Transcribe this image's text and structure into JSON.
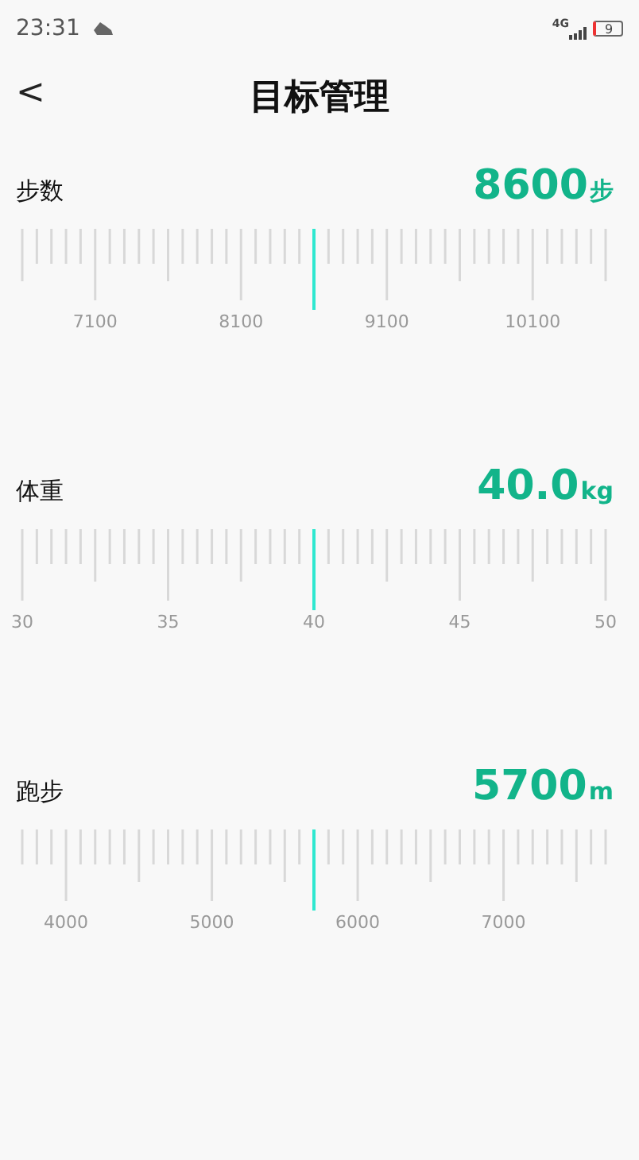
{
  "status_bar": {
    "time": "23:31",
    "network": "4G",
    "battery": "9"
  },
  "header": {
    "back": "<",
    "title": "目标管理"
  },
  "goals": [
    {
      "label": "步数",
      "value": "8600",
      "unit": "步",
      "scale_labels": [
        "7100",
        "8100",
        "9100",
        "10100"
      ]
    },
    {
      "label": "体重",
      "value": "40.0",
      "unit": "kg",
      "scale_labels": [
        "30",
        "35",
        "40",
        "45",
        "50"
      ]
    },
    {
      "label": "跑步",
      "value": "5700",
      "unit": "m",
      "scale_labels": [
        "4000",
        "5000",
        "6000",
        "7000"
      ]
    }
  ]
}
